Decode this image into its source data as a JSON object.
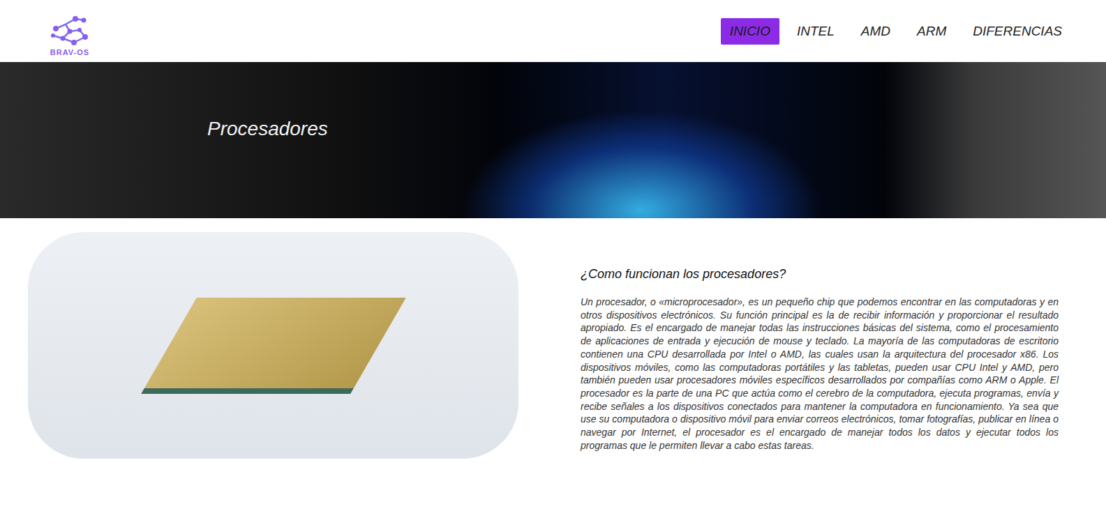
{
  "logo": {
    "text": "BRAV-OS"
  },
  "nav": [
    {
      "label": "INICIO",
      "selected": true
    },
    {
      "label": "INTEL",
      "selected": false
    },
    {
      "label": "AMD",
      "selected": false
    },
    {
      "label": "ARM",
      "selected": false
    },
    {
      "label": "DIFERENCIAS",
      "selected": false
    }
  ],
  "hero": {
    "title": "Procesadores"
  },
  "article": {
    "heading": "¿Como funcionan los procesadores?",
    "body": "Un procesador, o «microprocesador», es un pequeño chip que podemos encontrar en las computadoras y en otros dispositivos electrónicos. Su función principal es la de recibir información y proporcionar el resultado apropiado. Es el encargado de manejar todas las instrucciones básicas del sistema, como el procesamiento de aplicaciones de entrada y ejecución de mouse y teclado. La mayoría de las computadoras de escritorio contienen una CPU desarrollada por Intel o AMD, las cuales usan la arquitectura del procesador x86. Los dispositivos móviles, como las computadoras portátiles y las tabletas, pueden usar CPU Intel y AMD, pero también pueden usar procesadores móviles específicos desarrollados por compañías como ARM o Apple. El procesador es la parte de una PC que actúa como el cerebro de la computadora, ejecuta programas, envía y recibe señales a los dispositivos conectados para mantener la computadora en funcionamiento. Ya sea que use su computadora o dispositivo móvil para enviar correos electrónicos, tomar fotografías, publicar en línea o navegar por Internet, el procesador es el encargado de manejar todos los datos y ejecutar todos los programas que le permiten llevar a cabo estas tareas."
  }
}
